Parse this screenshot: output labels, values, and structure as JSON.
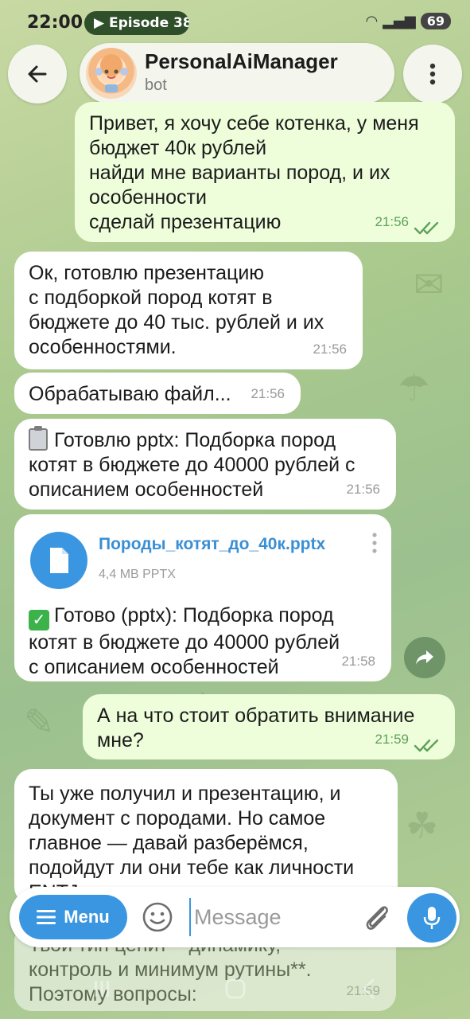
{
  "status_bar": {
    "time": "22:00",
    "episode": "▶ Episode 38",
    "battery": "69"
  },
  "header": {
    "bot_name": "PersonalAiManager",
    "subtitle": "bot"
  },
  "messages": [
    {
      "dir": "out",
      "text": "Привет, я хочу себе котенка, у меня\nбюджет 40к рублей\nнайди мне варианты пород, и их\nособенности\nсделай презентацию",
      "time": "21:56"
    },
    {
      "dir": "in",
      "text": "Ок, готовлю презентацию\nс подборкой пород котят в\nбюджете до 40 тыс. рублей и их\nособенностями.",
      "time": "21:56"
    },
    {
      "dir": "in",
      "text": "Обрабатываю файл...",
      "time": "21:56"
    },
    {
      "dir": "in",
      "text": "Готовлю pptx: Подборка пород\nкотят в бюджете до 40000 рублей с\nописанием особенностей",
      "time": "21:56",
      "emoji": "clipboard-emoji"
    },
    {
      "dir": "in",
      "file_name": "Породы_котят_до_40к.pptx",
      "file_meta": "4,4 MB PPTX",
      "text": "Готово (pptx): Подборка пород\nкотят в бюджете до 40000 рублей\nс описанием особенностей",
      "time": "21:58",
      "emoji": "check-mark-emoji"
    },
    {
      "dir": "out",
      "text": "А на что стоит обратить внимание\nмне?",
      "time": "21:59"
    },
    {
      "dir": "in",
      "text": "Ты уже получил и презентацию, и\nдокумент с породами. Но самое\nглавное — давай разберёмся,\nподойдут ли они тебе как личности\nENTJ"
    },
    {
      "dir": "in",
      "text": "Твой тип ценит **динамику,\nконтроль и минимум рутины**.\nПоэтому вопросы:",
      "time": "21:59"
    }
  ],
  "input": {
    "menu_label": "Menu",
    "placeholder": "Message"
  },
  "icons": {
    "back": "arrow-left-icon",
    "more": "more-vertical-icon",
    "file": "document-icon",
    "share": "share-icon",
    "emoji": "smile-icon",
    "attach": "paperclip-icon",
    "mic": "microphone-icon"
  },
  "colors": {
    "accent": "#3a96e0",
    "outgoing_bubble": "#eefedb",
    "incoming_bubble": "#ffffff",
    "read_check": "#5fa15a"
  }
}
